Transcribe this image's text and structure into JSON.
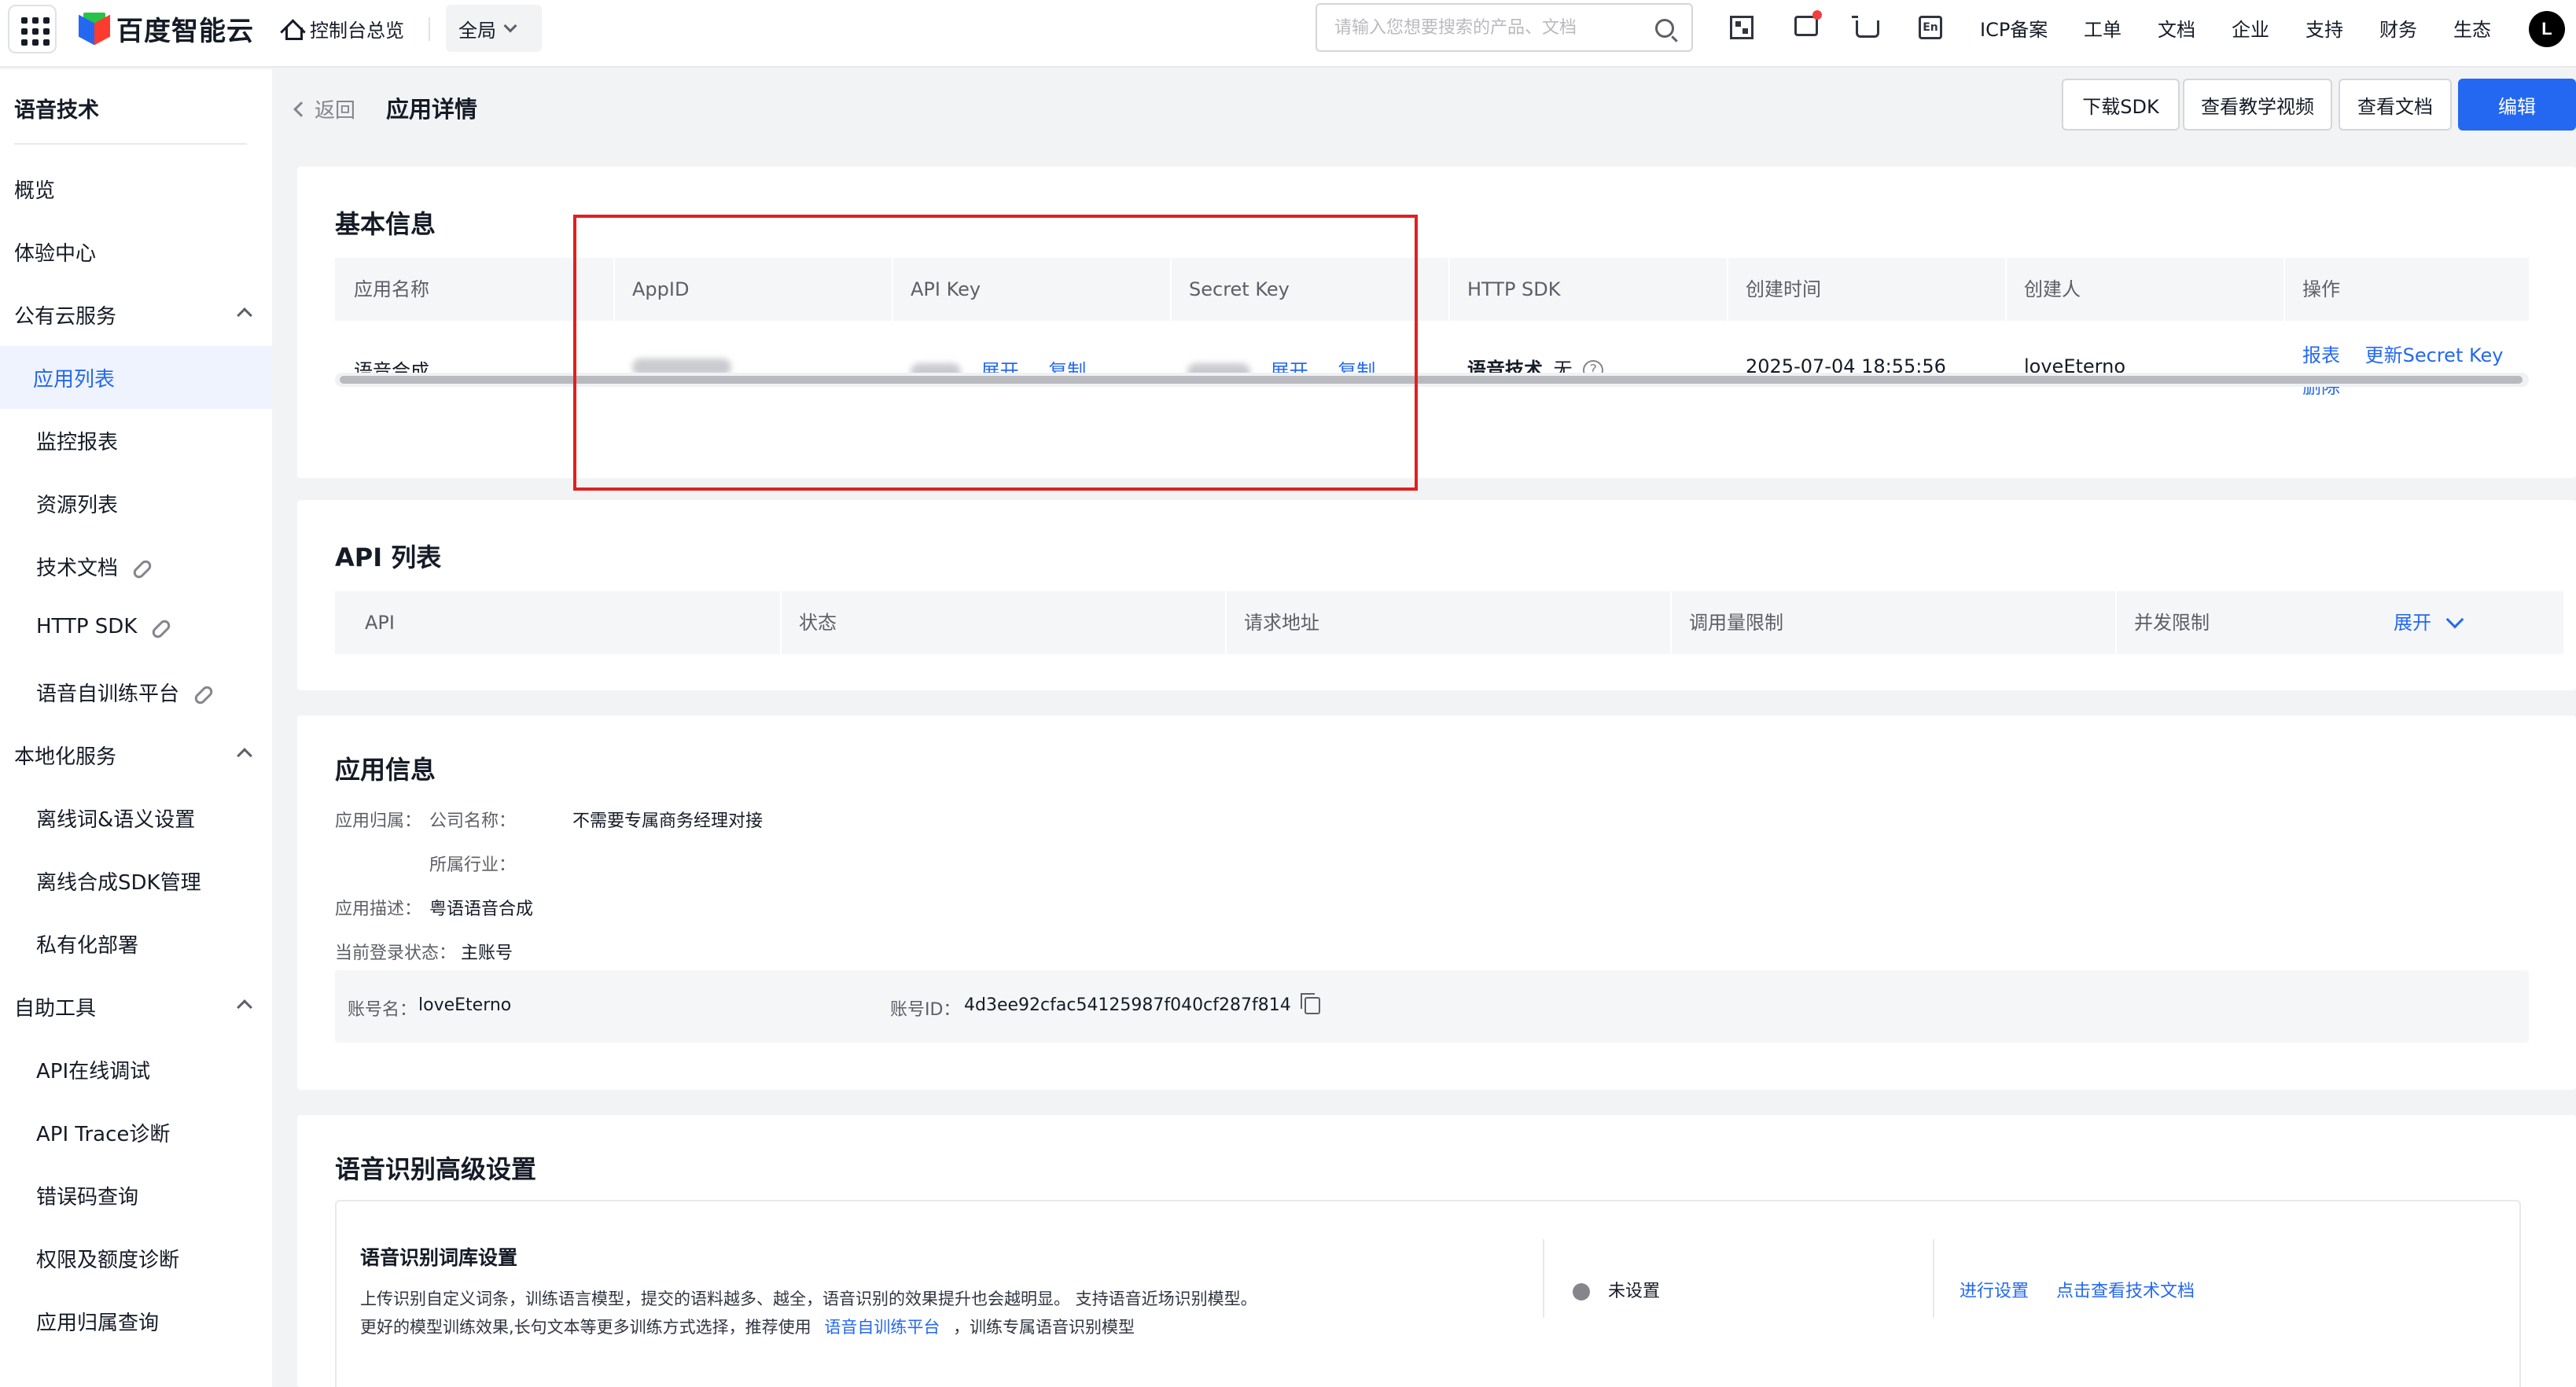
{
  "topbar": {
    "logo_text": "百度智能云",
    "home_label": "控制台总览",
    "scope_label": "全局",
    "search_placeholder": "请输入您想要搜索的产品、文档",
    "icons": [
      "qr-code-icon",
      "message-icon",
      "cart-icon",
      "language-en-icon"
    ],
    "en_label": "En",
    "nav": [
      "ICP备案",
      "工单",
      "文档",
      "企业",
      "支持",
      "财务",
      "生态"
    ],
    "avatar_letter": "L"
  },
  "sidebar": {
    "title": "语音技术",
    "items": [
      "概览",
      "体验中心"
    ],
    "group1": {
      "label": "公有云服务",
      "items": [
        "应用列表",
        "监控报表",
        "资源列表",
        "技术文档",
        "HTTP SDK",
        "语音自训练平台"
      ]
    },
    "group2": {
      "label": "本地化服务",
      "items": [
        "离线词&语义设置",
        "离线合成SDK管理",
        "私有化部署"
      ]
    },
    "group3": {
      "label": "自助工具",
      "items": [
        "API在线调试",
        "API Trace诊断",
        "错误码查询",
        "权限及额度诊断",
        "应用归属查询"
      ]
    },
    "active_item": "应用列表"
  },
  "header": {
    "back_label": "返回",
    "title": "应用详情",
    "buttons": [
      "下载SDK",
      "查看教学视频",
      "查看文档",
      "编辑"
    ]
  },
  "basic_info": {
    "title": "基本信息",
    "columns": [
      "应用名称",
      "AppID",
      "API Key",
      "Secret Key",
      "HTTP SDK",
      "创建时间",
      "创建人",
      "操作"
    ],
    "row": {
      "name": "语音合成",
      "expand": "展开",
      "copy": "复制",
      "sdk_name": "语音技术",
      "sdk_value": "无",
      "help": "?",
      "created": "2025-07-04 18:55:56",
      "creator": "loveEterno",
      "actions": [
        "报表",
        "更新Secret Key",
        "删除"
      ]
    }
  },
  "api_list": {
    "title": "API 列表",
    "columns": [
      "API",
      "状态",
      "请求地址",
      "调用量限制",
      "并发限制"
    ],
    "expand_label": "展开"
  },
  "app_info": {
    "title": "应用信息",
    "ownership_label": "应用归属：",
    "company_label": "公司名称：",
    "company_value": "不需要专属商务经理对接",
    "industry_label": "所属行业：",
    "industry_value": "",
    "desc_label": "应用描述：",
    "desc_value": "粤语语音合成",
    "login_label": "当前登录状态：",
    "login_value": "主账号",
    "account_name_label": "账号名：",
    "account_name": "loveEterno",
    "account_id_label": "账号ID：",
    "account_id": "4d3ee92cfac54125987f040cf287f814"
  },
  "asr_settings": {
    "title": "语音识别高级设置",
    "box_title": "语音识别词库设置",
    "desc_line1": "上传识别自定义词条，训练语言模型，提交的语料越多、越全，语音识别的效果提升也会越明显。 支持语音近场识别模型。",
    "desc_line2_pre": "更好的模型训练效果,长句文本等更多训练方式选择，推荐使用",
    "desc_line2_link": "语音自训练平台",
    "desc_line2_post": "，训练专属语音识别模型",
    "status": "未设置",
    "actions": [
      "进行设置",
      "点击查看技术文档"
    ]
  },
  "colors": {
    "primary": "#2468f2",
    "highlight": "#e02020",
    "active_bg": "#eef3fe"
  }
}
